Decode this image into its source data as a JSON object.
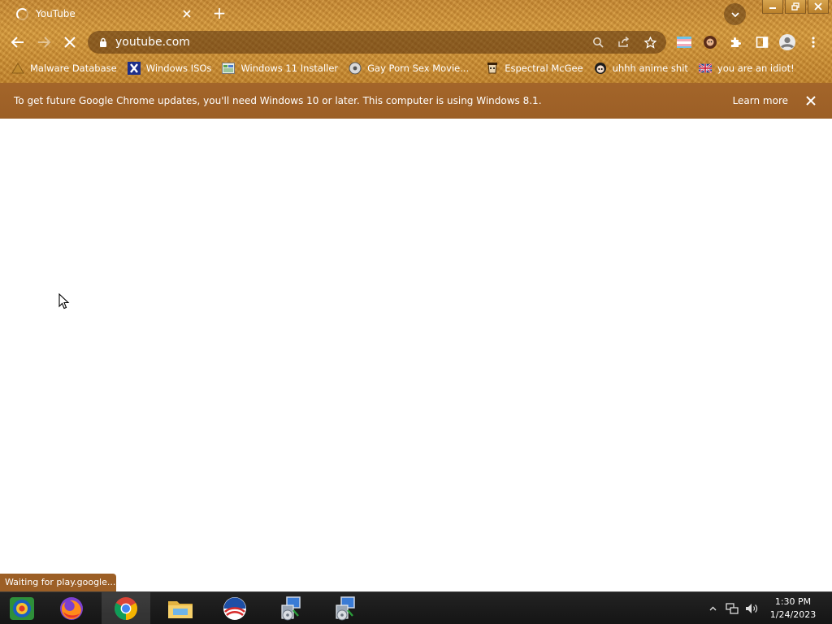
{
  "tab": {
    "title": "YouTube"
  },
  "omnibox": {
    "url": "youtube.com"
  },
  "bookmarks": [
    {
      "label": "Malware Database",
      "icon": "malware-icon"
    },
    {
      "label": "Windows ISOs",
      "icon": "x-icon"
    },
    {
      "label": "Windows 11 Installer",
      "icon": "installer-icon"
    },
    {
      "label": "Gay Porn Sex Movie...",
      "icon": "disc-icon"
    },
    {
      "label": "Espectral McGee",
      "icon": "face-icon"
    },
    {
      "label": "uhhh anime shit",
      "icon": "anime-icon"
    },
    {
      "label": "you are an idiot!",
      "icon": "flag-icon"
    }
  ],
  "infobar": {
    "message": "To get future Google Chrome updates, you'll need Windows 10 or later. This computer is using Windows 8.1.",
    "learn_more": "Learn more"
  },
  "status": {
    "text": "Waiting for play.google...."
  },
  "clock": {
    "time": "1:30 PM",
    "date": "1/24/2023"
  },
  "colors": {
    "theme": "#c88a35",
    "infobar": "#9c5f26",
    "taskbar": "#1c1c1c"
  }
}
